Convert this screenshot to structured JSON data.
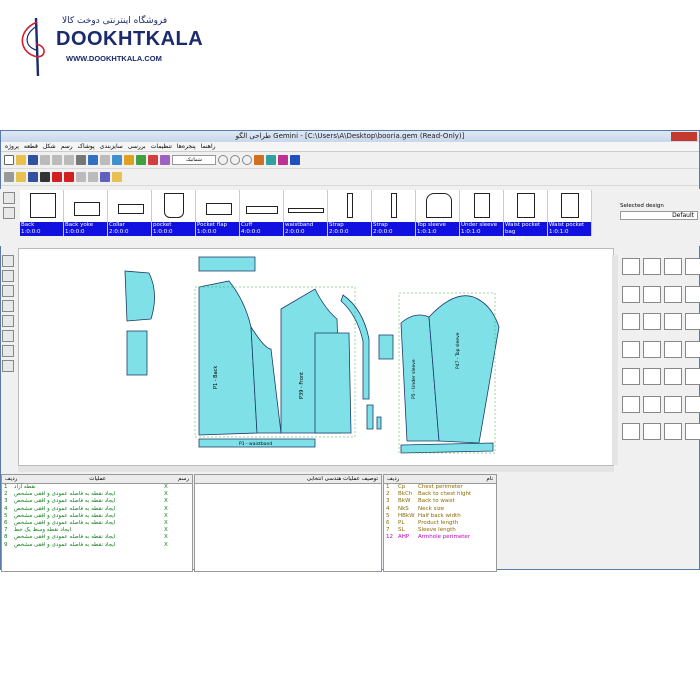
{
  "logo": {
    "persian": "فروشگاه اینترنتی دوخت کالا",
    "name": "DOOKHTKALA",
    "url": "WWW.DOOKHTKALA.COM"
  },
  "window": {
    "title_fa": "طراحی الگو",
    "title_path": "Gemini - [C:\\Users\\A\\Desktop\\booria.gem (Read-Only)]",
    "menu": [
      "پروژه",
      "قطعه",
      "شکل",
      "رسم",
      "پوشاک",
      "سایزبندی",
      "بررسی",
      "تنظیمات",
      "پنجره‌ها",
      "راهنما"
    ],
    "combo_text": "شماتیک"
  },
  "pieces": [
    {
      "name": "Back",
      "code": "1:0:0:0"
    },
    {
      "name": "Back yoke",
      "code": "1:0:0:0"
    },
    {
      "name": "Collar",
      "code": "2:0:0:0"
    },
    {
      "name": "pocket",
      "code": "1:0:0:0"
    },
    {
      "name": "Pocket flap",
      "code": "1:0:0:0"
    },
    {
      "name": "Cuff",
      "code": "4:0:0:0"
    },
    {
      "name": "waistband",
      "code": "2:0:0:0"
    },
    {
      "name": "Strap",
      "code": "2:0:0:0"
    },
    {
      "name": "Strap",
      "code": "2:0:0:0"
    },
    {
      "name": "Top sleeve",
      "code": "1:0:1:0"
    },
    {
      "name": "Under sleeve",
      "code": "1:0:1:0"
    },
    {
      "name": "Waist pocket bag",
      "code": "1:0:1:0"
    },
    {
      "name": "Waist pocket",
      "code": "1:0:1:0"
    }
  ],
  "selected_design": {
    "label": "Selected design",
    "value": "Default"
  },
  "canvas_labels": {
    "front": "P39 - Front",
    "back": "P1 - Back",
    "top_sleeve": "P47 - Top sleeve",
    "under_sleeve": "P5 - Under sleeve",
    "waistband": "P1 - waistband"
  },
  "operations": {
    "header_num": "ردیف",
    "header_ops": "عملیات",
    "header_draw": "رسم",
    "rows": [
      {
        "n": "1",
        "text": "نقطه آزاد",
        "x": "X"
      },
      {
        "n": "2",
        "text": "ایجاد نقطه به فاصله عمودی و افقی مشخص",
        "x": "X"
      },
      {
        "n": "3",
        "text": "ایجاد نقطه به فاصله عمودی و افقی مشخص",
        "x": "X"
      },
      {
        "n": "4",
        "text": "ایجاد نقطه به فاصله عمودی و افقی مشخص",
        "x": "X"
      },
      {
        "n": "5",
        "text": "ایجاد نقطه به فاصله عمودی و افقی مشخص",
        "x": "X"
      },
      {
        "n": "6",
        "text": "ایجاد نقطه به فاصله عمودی و افقی مشخص",
        "x": "X"
      },
      {
        "n": "7",
        "text": "ایجاد نقطه وسط یک خط",
        "x": "X"
      },
      {
        "n": "8",
        "text": "ایجاد نقطه به فاصله عمودی و افقی مشخص",
        "x": "X"
      },
      {
        "n": "9",
        "text": "ایجاد نقطه به فاصله عمودی و افقی مشخص",
        "x": "X"
      }
    ]
  },
  "description": {
    "header": "توصیف عملیات هندسی انتخابی"
  },
  "measurements": {
    "header_num": "ردیف",
    "header_name": "نام",
    "rows": [
      {
        "n": "1",
        "code": "Cp",
        "name": "Chest perimeter"
      },
      {
        "n": "2",
        "code": "BkCh",
        "name": "Back to chest hight"
      },
      {
        "n": "3",
        "code": "BkW",
        "name": "Back to waist"
      },
      {
        "n": "4",
        "code": "NkS",
        "name": "Neck size"
      },
      {
        "n": "5",
        "code": "HBkW",
        "name": "Half back width"
      },
      {
        "n": "6",
        "code": "PL",
        "name": "Product length"
      },
      {
        "n": "7",
        "code": "SL",
        "name": "Sleeve length"
      },
      {
        "n": "12",
        "code": "AHP",
        "name": "Armhole perimeter"
      }
    ]
  },
  "colors": {
    "piece_fill": "#7fe0e8",
    "label_bar": "#1010e0",
    "ops_text": "#11801a",
    "meas_text": "#8a6a00",
    "meas_highlight": "#c000c0"
  }
}
